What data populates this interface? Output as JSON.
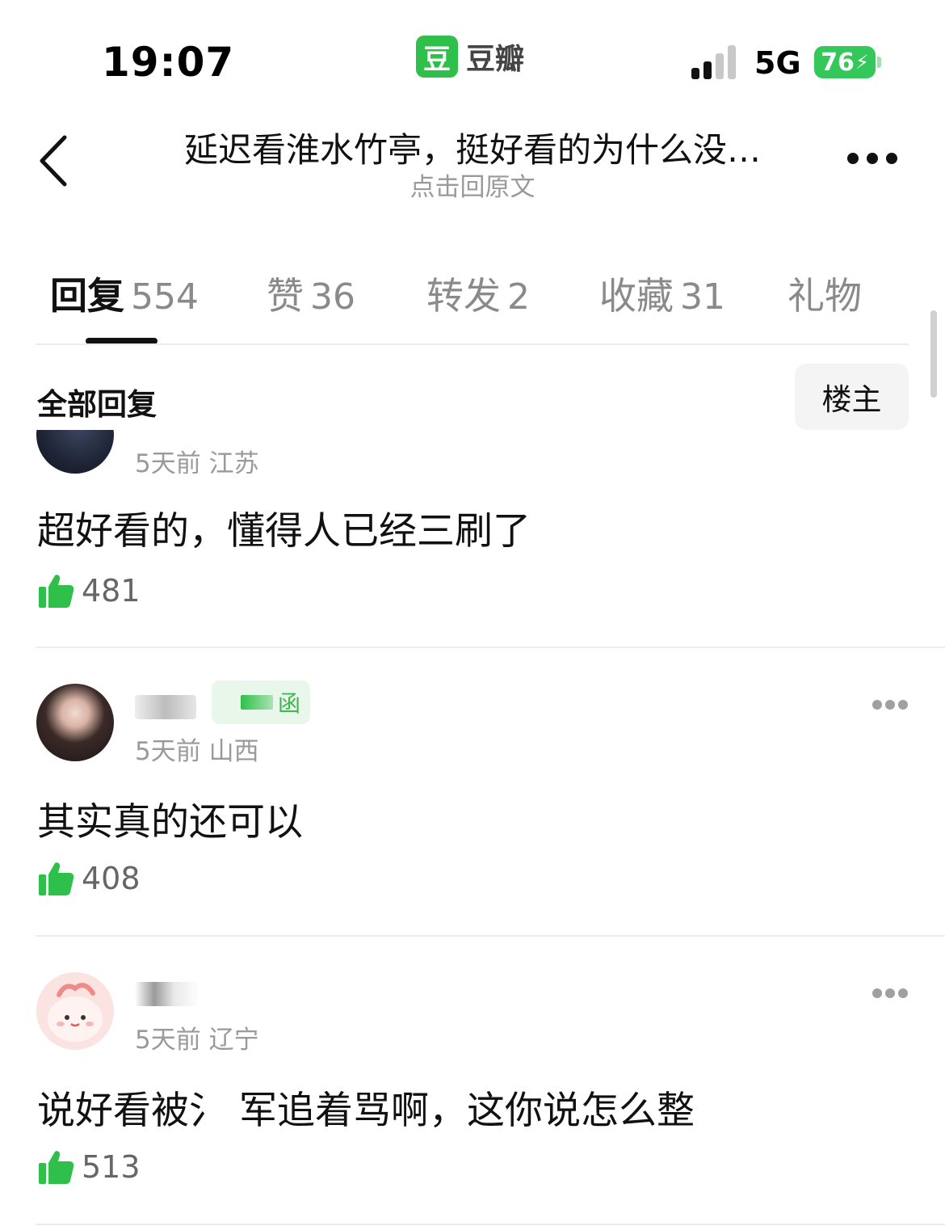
{
  "status_bar": {
    "time": "19:07",
    "app_logo_glyph": "豆",
    "app_name": "豆瓣",
    "network": "5G",
    "battery": "76",
    "battery_color": "#34c759"
  },
  "header": {
    "title": "延迟看淮水竹亭，挺好看的为什么没…",
    "subtitle": "点击回原文"
  },
  "tabs": [
    {
      "label": "回复",
      "count": "554",
      "active": true
    },
    {
      "label": "赞",
      "count": "36",
      "active": false
    },
    {
      "label": "转发",
      "count": "2",
      "active": false
    },
    {
      "label": "收藏",
      "count": "31",
      "active": false
    },
    {
      "label": "礼物",
      "count": "",
      "active": false
    }
  ],
  "filter": {
    "label": "全部回复",
    "op_button": "楼主"
  },
  "comments": [
    {
      "meta": "5天前 江苏",
      "text": "超好看的，懂得人已经三刷了",
      "likes": "481",
      "avatar_icon": "user-avatar-photo"
    },
    {
      "meta": "5天前 山西",
      "text": "其实真的还可以",
      "likes": "408",
      "badge_glyph": "函",
      "avatar_icon": "user-avatar-photo"
    },
    {
      "meta": "5天前 辽宁",
      "text": "说好看被氵 军追着骂啊，这你说怎么整",
      "likes": "513",
      "avatar_icon": "cartoon-avatar"
    }
  ],
  "colors": {
    "brand_green": "#2ec04a",
    "like_green": "#2ec04a",
    "muted_text": "#9a9a9a"
  }
}
